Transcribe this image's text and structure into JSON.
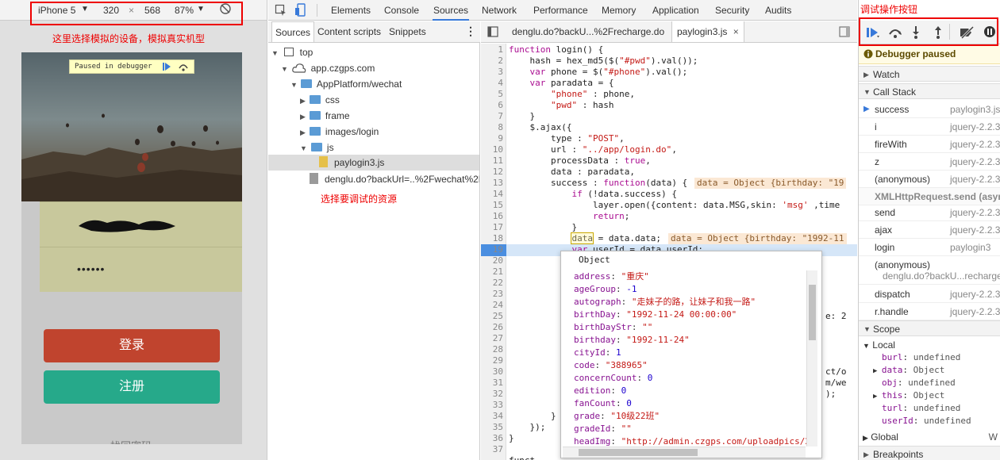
{
  "device_toolbar": {
    "device": "iPhone 5",
    "width": "320",
    "times": "×",
    "height": "568",
    "zoom": "87%"
  },
  "annotations": {
    "device_note": "这里选择模拟的设备，模拟真实机型",
    "resource_note": "选择要调试的资源",
    "buttons_note": "调试操作按钮"
  },
  "device_screen": {
    "paused_label": "Paused in debugger",
    "password_mask": "••••••",
    "login_label": "登录",
    "register_label": "注册",
    "bottom_link": "找回密码"
  },
  "devtools_tabs": [
    "Elements",
    "Console",
    "Sources",
    "Network",
    "Performance",
    "Memory",
    "Application",
    "Security",
    "Audits"
  ],
  "navigator": {
    "tabs": [
      "Sources",
      "Content scripts",
      "Snippets"
    ],
    "tree": {
      "top": "top",
      "domain": "app.czgps.com",
      "app_folder": "AppPlatform/wechat",
      "folders": [
        "css",
        "frame",
        "images/login",
        "js"
      ],
      "selected_file": "paylogin3.js",
      "other_file": "denglu.do?backUrl=..%2Fwechat%2F"
    }
  },
  "editor": {
    "tabs": [
      "denglu.do?backU...%2Frecharge.do",
      "paylogin3.js"
    ],
    "line_numbers": [
      "1",
      "2",
      "3",
      "4",
      "5",
      "6",
      "7",
      "8",
      "9",
      "10",
      "11",
      "12",
      "13",
      "14",
      "15",
      "16",
      "17",
      "18",
      "19",
      "20",
      "21",
      "22",
      "23",
      "24",
      "25",
      "26",
      "27",
      "28",
      "29",
      "30",
      "31",
      "32",
      "33",
      "34",
      "35",
      "36",
      "37"
    ],
    "code_lines": [
      "function login() {",
      "    hash = hex_md5($(\"#pwd\").val());",
      "    var phone = $(\"#phone\").val();",
      "    var paradata = {",
      "        \"phone\" : phone,",
      "        \"pwd\" : hash",
      "    }",
      "    $.ajax({",
      "        type : \"POST\",",
      "        url : \"../app/login.do\",",
      "        processData : true,",
      "        data : paradata,",
      "        success : function(data) {",
      "            if (!data.success) {",
      "                layer.open({content: data.MSG,skin: 'msg' ,time",
      "                return;",
      "            }",
      "            data = data.data;",
      "            var userId = data.userId;"
    ],
    "inline_val_13": "data = Object {birthday: \"19",
    "inline_val_18": "data = Object {birthday: \"1992-11",
    "line_25_tail": "e: 2",
    "line_30_tail": "ct/o",
    "line_31_tail": "m/we",
    "line_32_tail": ");",
    "line_34": "        }",
    "line_35": "    });",
    "line_36": "}",
    "line_37": "funct"
  },
  "object_popover": {
    "title": "Object",
    "props": [
      {
        "k": "address",
        "v": "\"重庆\"",
        "t": "s"
      },
      {
        "k": "ageGroup",
        "v": "-1",
        "t": "n"
      },
      {
        "k": "autograph",
        "v": "\"走妹子的路，让妹子和我一路\"",
        "t": "s"
      },
      {
        "k": "birthDay",
        "v": "\"1992-11-24 00:00:00\"",
        "t": "s"
      },
      {
        "k": "birthDayStr",
        "v": "\"\"",
        "t": "s"
      },
      {
        "k": "birthday",
        "v": "\"1992-11-24\"",
        "t": "s"
      },
      {
        "k": "cityId",
        "v": "1",
        "t": "n"
      },
      {
        "k": "code",
        "v": "\"388965\"",
        "t": "s"
      },
      {
        "k": "concernCount",
        "v": "0",
        "t": "n"
      },
      {
        "k": "edition",
        "v": "0",
        "t": "n"
      },
      {
        "k": "fanCount",
        "v": "0",
        "t": "n"
      },
      {
        "k": "grade",
        "v": "\"10级22班\"",
        "t": "s"
      },
      {
        "k": "gradeId",
        "v": "\"\"",
        "t": "s"
      },
      {
        "k": "headImg",
        "v": "\"http://admin.czgps.com/uploadpics/2",
        "t": "s"
      }
    ]
  },
  "debugger": {
    "paused_text": "Debugger paused",
    "sections": {
      "watch": "Watch",
      "call_stack": "Call Stack",
      "scope": "Scope",
      "global": "Global",
      "global_tail": "W",
      "breakpoints": "Breakpoints"
    },
    "frames": [
      {
        "fn": "success",
        "loc": "paylogin3.js"
      },
      {
        "fn": "i",
        "loc": "jquery-2.2.3"
      },
      {
        "fn": "fireWith",
        "loc": "jquery-2.2.3"
      },
      {
        "fn": "z",
        "loc": "jquery-2.2.3"
      },
      {
        "fn": "(anonymous)",
        "loc": "jquery-2.2.3"
      },
      {
        "fn": "XMLHttpRequest.send (async)",
        "loc": ""
      },
      {
        "fn": "send",
        "loc": "jquery-2.2.3"
      },
      {
        "fn": "ajax",
        "loc": "jquery-2.2.3"
      },
      {
        "fn": "login",
        "loc": "paylogin3"
      },
      {
        "fn": "(anonymous)",
        "loc": ""
      },
      {
        "fn": "dispatch",
        "loc": "jquery-2.2.3"
      },
      {
        "fn": "r.handle",
        "loc": "jquery-2.2.3"
      }
    ],
    "anon_sub": "denglu.do?backU...recharge",
    "local_label": "Local",
    "local_vars": [
      {
        "k": "burl",
        "v": "undefined",
        "exp": false
      },
      {
        "k": "data",
        "v": "Object",
        "exp": true
      },
      {
        "k": "obj",
        "v": "undefined",
        "exp": false
      },
      {
        "k": "this",
        "v": "Object",
        "exp": true
      },
      {
        "k": "turl",
        "v": "undefined",
        "exp": false
      },
      {
        "k": "userId",
        "v": "undefined",
        "exp": false
      }
    ]
  },
  "colors": {
    "login_btn": "#c0442e",
    "register_btn": "#26a98a",
    "annotation_red": "#e00000",
    "devtools_blue": "#3879d9"
  }
}
